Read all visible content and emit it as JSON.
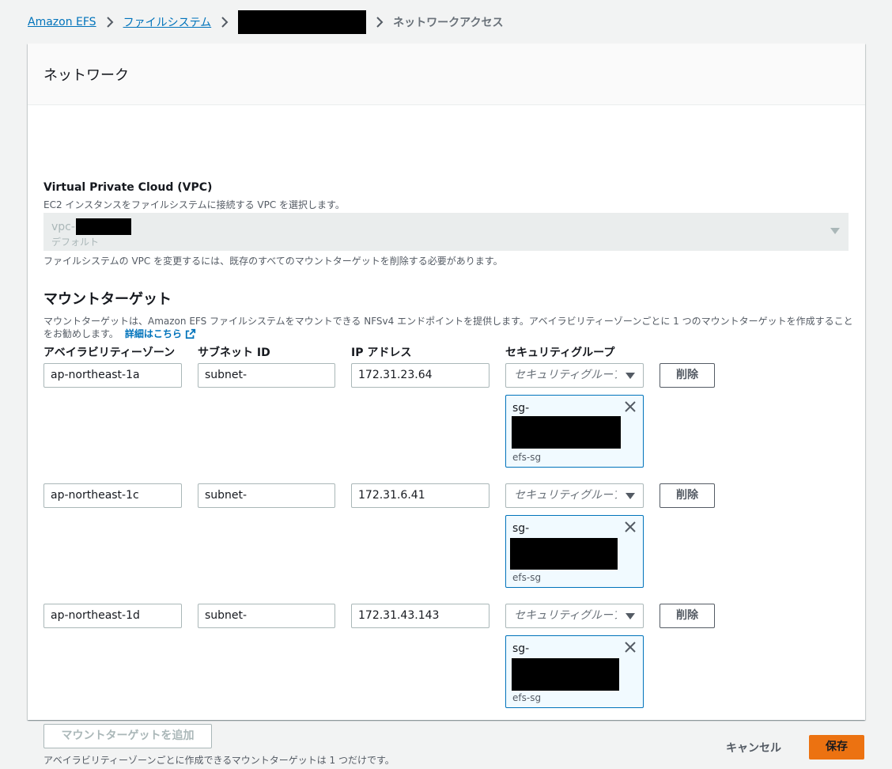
{
  "breadcrumb": {
    "items": [
      "Amazon EFS",
      "ファイルシステム"
    ],
    "current": "ネットワークアクセス"
  },
  "panel": {
    "title": "ネットワーク",
    "vpc": {
      "label": "Virtual Private Cloud (VPC)",
      "description": "EC2 インスタンスをファイルシステムに接続する VPC を選択します。",
      "selected_prefix": "vpc-",
      "selected_tag": "デフォルト",
      "help": "ファイルシステムの VPC を変更するには、既存のすべてのマウントターゲットを削除する必要があります。"
    },
    "mount_targets": {
      "title": "マウントターゲット",
      "description_line1": "マウントターゲットは、Amazon EFS ファイルシステムをマウントできる NFSv4 エンドポイントを提供します。アベイラビリティーゾーンごとに 1 つのマウントターゲットを作成すること",
      "description_line2": "をお勧めします。",
      "learn_more": "詳細はこちら",
      "columns": {
        "az": "アベイラビリティーゾーン",
        "subnet": "サブネット ID",
        "ip": "IP アドレス",
        "sg": "セキュリティグループ"
      },
      "sg_placeholder": "セキュリティグループを選択",
      "delete_label": "削除",
      "rows": [
        {
          "az": "ap-northeast-1a",
          "subnet": "subnet-",
          "ip": "172.31.23.64",
          "sg_id_prefix": "sg-",
          "sg_name": "efs-sg"
        },
        {
          "az": "ap-northeast-1c",
          "subnet": "subnet-",
          "ip": "172.31.6.41",
          "sg_id_prefix": "sg-",
          "sg_name": "efs-sg"
        },
        {
          "az": "ap-northeast-1d",
          "subnet": "subnet-",
          "ip": "172.31.43.143",
          "sg_id_prefix": "sg-",
          "sg_name": "efs-sg"
        }
      ],
      "add_button": "マウントターゲットを追加",
      "add_help": "アベイラビリティーゾーンごとに作成できるマウントターゲットは 1 つだけです。"
    }
  },
  "footer": {
    "cancel": "キャンセル",
    "save": "保存"
  },
  "colors": {
    "link": "#0073bb",
    "primary": "#ec7211"
  }
}
